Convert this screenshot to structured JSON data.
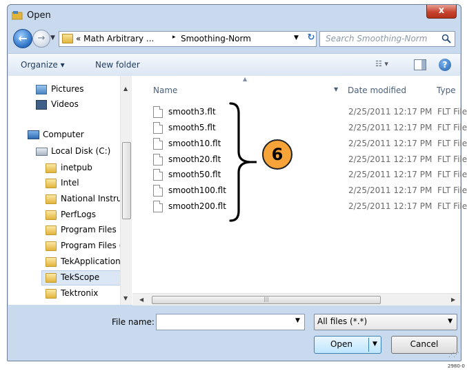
{
  "window": {
    "title": "Open",
    "close_label": "x"
  },
  "address_bar": {
    "crumb1": "« Math Arbitrary ...",
    "separator": "▸",
    "crumb2": "Smoothing-Norm",
    "search_placeholder": "Search Smoothing-Norm"
  },
  "toolbar": {
    "organize_label": "Organize ▾",
    "new_folder_label": "New folder",
    "views_label": "☷ ▾",
    "help_label": "?"
  },
  "nav": {
    "items": [
      {
        "label": "Pictures",
        "icon": "pictures-icon"
      },
      {
        "label": "Videos",
        "icon": "videos-icon"
      },
      {
        "label": "Computer",
        "icon": "computer-icon"
      },
      {
        "label": "Local Disk (C:)",
        "icon": "disk-icon"
      },
      {
        "label": "inetpub",
        "icon": "folder-icon"
      },
      {
        "label": "Intel",
        "icon": "folder-icon"
      },
      {
        "label": "National Instru",
        "icon": "folder-icon"
      },
      {
        "label": "PerfLogs",
        "icon": "folder-icon"
      },
      {
        "label": "Program Files",
        "icon": "folder-icon"
      },
      {
        "label": "Program Files (",
        "icon": "folder-icon"
      },
      {
        "label": "TekApplication",
        "icon": "folder-icon"
      },
      {
        "label": "TekScope",
        "icon": "folder-icon",
        "selected": true
      },
      {
        "label": "Tektronix",
        "icon": "folder-icon"
      }
    ]
  },
  "columns": {
    "name": "Name",
    "date_modified": "Date modified",
    "type": "Type"
  },
  "files": [
    {
      "name": "smooth3.flt",
      "date": "2/25/2011 12:17 PM",
      "type": "FLT File"
    },
    {
      "name": "smooth5.flt",
      "date": "2/25/2011 12:17 PM",
      "type": "FLT File"
    },
    {
      "name": "smooth10.flt",
      "date": "2/25/2011 12:17 PM",
      "type": "FLT File"
    },
    {
      "name": "smooth20.flt",
      "date": "2/25/2011 12:17 PM",
      "type": "FLT File"
    },
    {
      "name": "smooth50.flt",
      "date": "2/25/2011 12:17 PM",
      "type": "FLT File"
    },
    {
      "name": "smooth100.flt",
      "date": "2/25/2011 12:17 PM",
      "type": "FLT File"
    },
    {
      "name": "smooth200.flt",
      "date": "2/25/2011 12:17 PM",
      "type": "FLT File"
    }
  ],
  "callout": {
    "number": "6"
  },
  "bottom": {
    "file_name_label": "File name:",
    "file_name_value": "",
    "filter_value": "All files (*.*)",
    "open_label": "Open",
    "cancel_label": "Cancel"
  },
  "figure_id": "2980-0",
  "colors": {
    "frame": "#c9daee",
    "callout": "#f6a33a",
    "selection": "#dbe7f5"
  }
}
